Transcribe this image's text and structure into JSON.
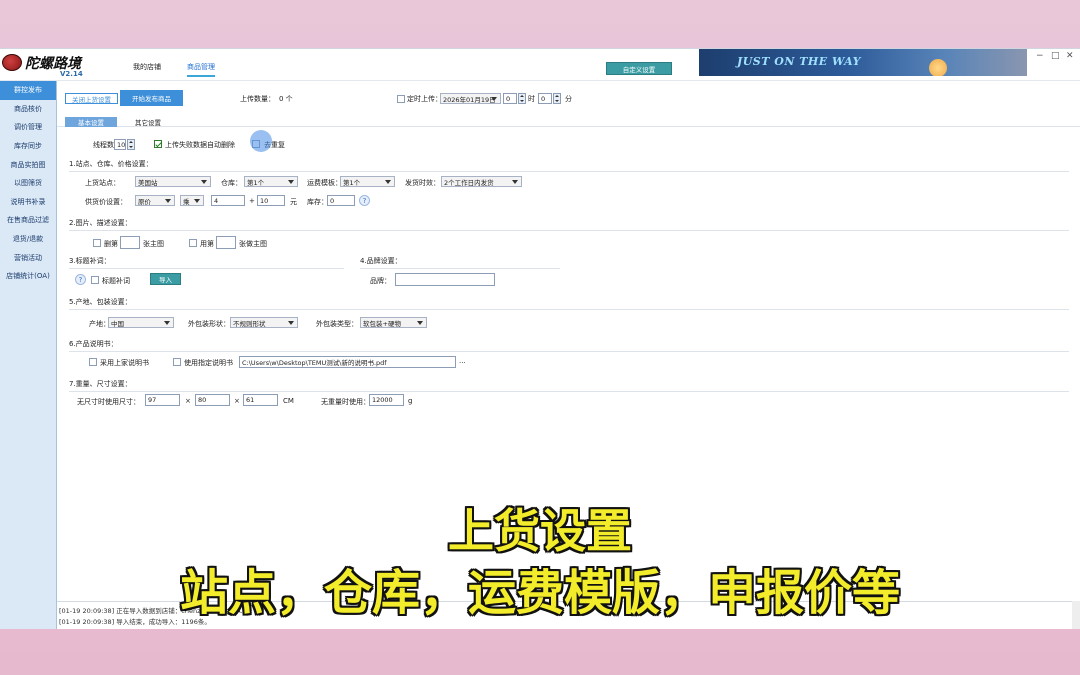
{
  "app": {
    "name": "陀螺路境",
    "version": "V2.14"
  },
  "nav_tabs": [
    {
      "label": "我的店铺"
    },
    {
      "label": "商品管理"
    }
  ],
  "custom_settings_btn": "自定义设置",
  "banner_text": "JUST ON THE WAY",
  "window_controls": {
    "minimize": "−",
    "maximize": "□",
    "close": "✕"
  },
  "sidebar": {
    "items": [
      {
        "label": "群控发布",
        "active": true
      },
      {
        "label": "商品核价"
      },
      {
        "label": "调价管理"
      },
      {
        "label": "库存同步"
      },
      {
        "label": "商品实拍图"
      },
      {
        "label": "以图筛货"
      },
      {
        "label": "说明书补录"
      },
      {
        "label": "在售商品过滤"
      },
      {
        "label": "退货/退款"
      },
      {
        "label": "营销活动"
      },
      {
        "label": "店铺统计(OA)"
      }
    ]
  },
  "toolbar": {
    "close_upload_settings": "关闭上货设置",
    "start_publish": "开始发布商品",
    "upload_count_label": "上传数量：",
    "upload_count_value": "0 个",
    "scheduled_upload_label": "定时上传：",
    "scheduled_date": "2026年01月19日",
    "hour_value": "0",
    "hour_unit": "时",
    "minute_value": "0",
    "minute_unit": "分"
  },
  "subtabs": [
    {
      "label": "基本设置",
      "active": true
    },
    {
      "label": "其它设置"
    }
  ],
  "thread": {
    "label": "线程数量：",
    "value": "10",
    "auto_delete_label": "上传失败数据自动删除",
    "dedupe_label": "去重复"
  },
  "section1": {
    "title": "1.站点、仓库、价格设置：",
    "site_label": "上货站点：",
    "site_value": "美国站",
    "warehouse_label": "仓库：",
    "warehouse_value": "第1个",
    "shipping_label": "运费模板：",
    "shipping_value": "第1个",
    "ship_time_label": "发货时效：",
    "ship_time_value": "2个工作日内发货",
    "price_label": "供货价设置：",
    "price_base": "原价",
    "price_op": "乘",
    "multiplier": "4",
    "plus": "+",
    "addend": "10",
    "currency": "元",
    "stock_label": "库存：",
    "stock_value": "0"
  },
  "section2": {
    "title": "2.图片、描述设置：",
    "delete_label": "删第",
    "delete_suffix": "张主图",
    "use_label": "用第",
    "use_suffix": "张做主图"
  },
  "section3": {
    "title": "3.标题补词：",
    "supplement_label": "标题补词",
    "import_btn": "导入"
  },
  "section4": {
    "title": "4.品牌设置：",
    "brand_label": "品牌："
  },
  "section5": {
    "title": "5.产地、包装设置：",
    "origin_label": "产地：",
    "origin_value": "中国",
    "shape_label": "外包装形状：",
    "shape_value": "不规则形状",
    "pack_type_label": "外包装类型：",
    "pack_type_value": "软包装+硬物"
  },
  "section6": {
    "title": "6.产品说明书：",
    "use_store_label": "采用上家说明书",
    "use_specified_label": "使用指定说明书",
    "file_path": "C:\\Users\\w\\Desktop\\TEMU测试\\新的说明书.pdf",
    "browse": "..."
  },
  "section7": {
    "title": "7.重量、尺寸设置：",
    "no_size_label": "无尺寸时使用尺寸：",
    "length": "97",
    "width": "80",
    "height": "61",
    "times": "×",
    "size_unit": "CM",
    "no_weight_label": "无重量时使用：",
    "weight": "12000",
    "weight_unit": "g"
  },
  "log": [
    "[01-19 20:09:38] 正在导入数据到店铺：chenzhilong电AAA.",
    "[01-19 20:09:38] 导入结束，成功导入：1196条。"
  ],
  "captions": {
    "line1": "上货设置",
    "line2": "站点，仓库，运费模版，申报价等"
  },
  "colors": {
    "accent": "#3d8fd9",
    "teal": "#3b9da3",
    "caption": "#f3ec2a"
  }
}
